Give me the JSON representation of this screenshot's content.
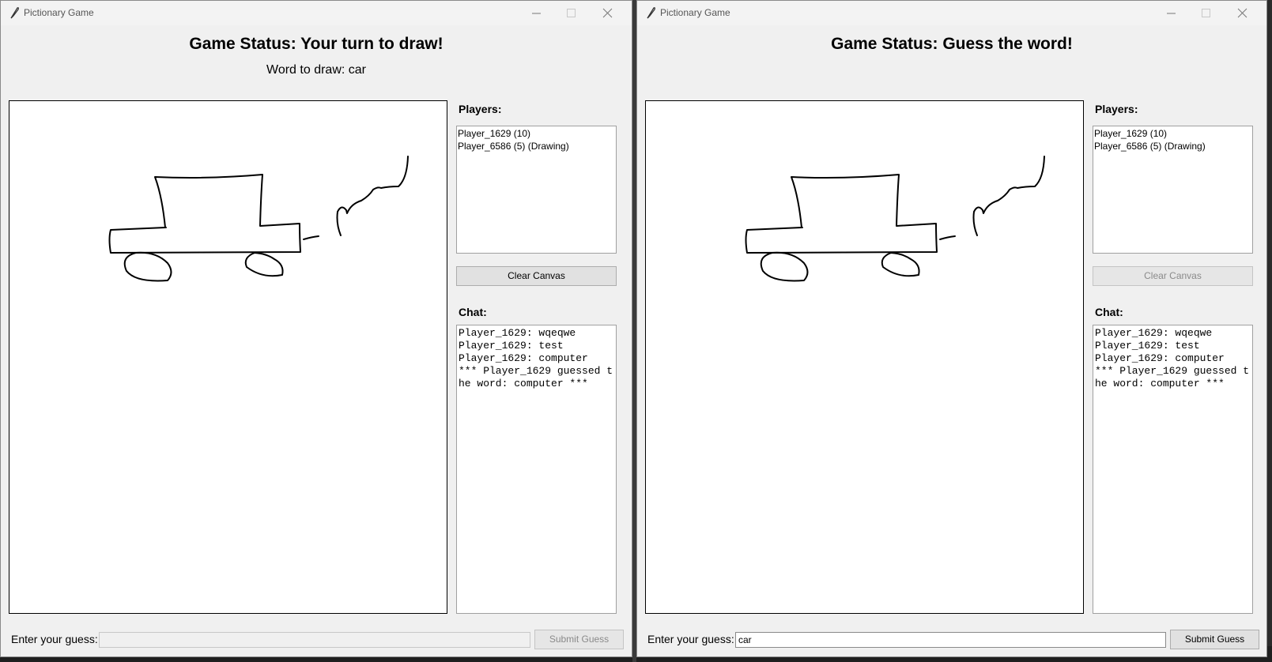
{
  "windows": [
    {
      "title": "Pictionary Game",
      "status": "Game Status: Your turn to draw!",
      "word_to_draw": "Word to draw: car",
      "players_label": "Players:",
      "players": [
        "Player_1629 (10)",
        "Player_6586 (5) (Drawing)"
      ],
      "clear_canvas_label": "Clear Canvas",
      "clear_canvas_enabled": true,
      "chat_label": "Chat:",
      "chat": [
        "Player_1629: wqeqwe",
        "Player_1629: test",
        "Player_1629: computer",
        "*** Player_1629 guessed the word: computer ***"
      ],
      "guess_label": "Enter your guess:",
      "guess_value": "",
      "guess_enabled": false,
      "submit_label": "Submit Guess",
      "submit_enabled": false
    },
    {
      "title": "Pictionary Game",
      "status": "Game Status: Guess the word!",
      "word_to_draw": "",
      "players_label": "Players:",
      "players": [
        "Player_1629 (10)",
        "Player_6586 (5) (Drawing)"
      ],
      "clear_canvas_label": "Clear Canvas",
      "clear_canvas_enabled": false,
      "chat_label": "Chat:",
      "chat": [
        "Player_1629: wqeqwe",
        "Player_1629: test",
        "Player_1629: computer",
        "*** Player_1629 guessed the word: computer ***"
      ],
      "guess_label": "Enter your guess:",
      "guess_value": "car",
      "guess_enabled": true,
      "submit_label": "Submit Guess",
      "submit_enabled": true
    }
  ],
  "icons": {
    "app": "feather-icon",
    "minimize": "minimize-icon",
    "maximize": "maximize-icon",
    "close": "close-icon"
  },
  "colors": {
    "window_bg": "#f0f0f0",
    "canvas_bg": "#ffffff",
    "stroke": "#000000"
  }
}
